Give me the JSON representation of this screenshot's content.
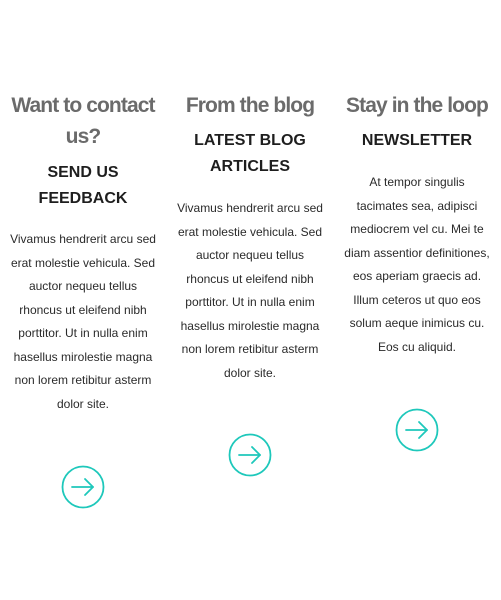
{
  "columns": [
    {
      "heading": "Want to contact us?",
      "subheading": "SEND US FEEDBACK",
      "body": "Vivamus hendrerit arcu sed erat molestie vehicula. Sed auctor nequeu tellus rhoncus ut eleifend nibh porttitor. Ut in nulla enim hasellus mirolestie magna non lorem retibitur asterm dolor site.",
      "arrow_icon": "arrow-right-circle-icon"
    },
    {
      "heading": "From the blog",
      "subheading": "LATEST BLOG ARTICLES",
      "body": "Vivamus hendrerit arcu sed erat molestie vehicula. Sed auctor nequeu tellus rhoncus ut eleifend nibh porttitor. Ut in nulla enim hasellus mirolestie magna non lorem retibitur asterm dolor site.",
      "arrow_icon": "arrow-right-circle-icon"
    },
    {
      "heading": "Stay in the loop",
      "subheading": "NEWSLETTER",
      "body": "At tempor singulis tacimates sea, adipisci mediocrem vel cu. Mei te diam assentior definitiones, eos aperiam graecis ad. Illum ceteros ut quo eos solum aeque inimicus cu. Eos cu aliquid.",
      "arrow_icon": "arrow-right-circle-icon"
    }
  ],
  "colors": {
    "heading": "#6b6b6b",
    "subheading": "#1e1e1e",
    "body": "#2a2a2a",
    "accent": "#1ec8bb"
  }
}
